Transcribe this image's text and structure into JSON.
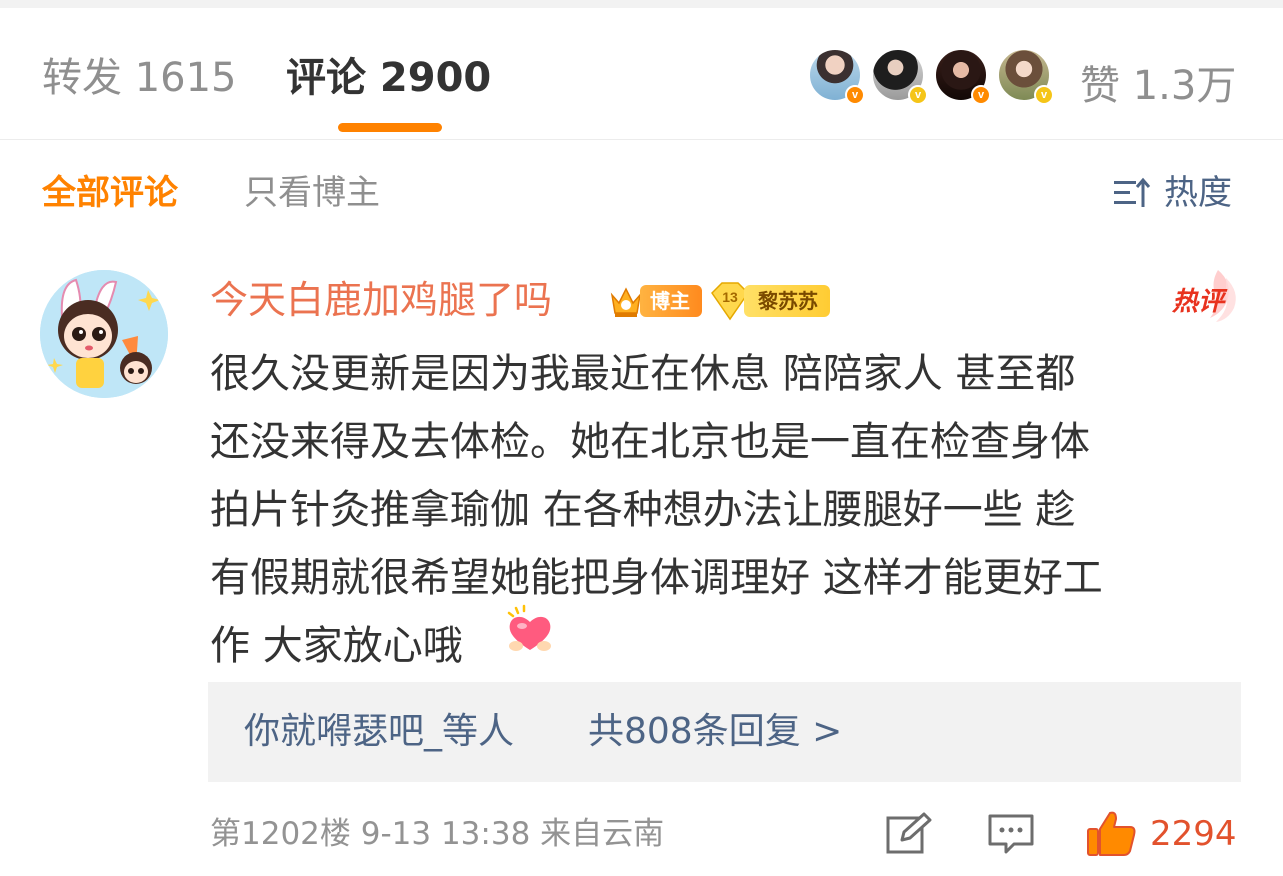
{
  "tabs": {
    "repost": "转发 1615",
    "comments": "评论 2900",
    "like_count": "赞 1.3万"
  },
  "filters": {
    "all": "全部评论",
    "blogger_only": "只看博主",
    "sort": "热度"
  },
  "comment": {
    "username": "今天白鹿加鸡腿了吗",
    "badge_blogger": "博主",
    "badge_fan_level": "13",
    "badge_fan_name": "黎苏苏",
    "hot_tag": "热评",
    "text": "很久没更新是因为我最近在休息 陪陪家人 甚至都\n还没来得及去体检。她在北京也是一直在检查身体\n拍片针灸推拿瑜伽 在各种想办法让腰腿好一些 趁\n有假期就很希望她能把身体调理好 这样才能更好工\n作 大家放心哦",
    "replies_users": "你就嘚瑟吧_等人",
    "replies_count": "共808条回复 >",
    "meta": "第1202楼 9-13 13:38 来自云南",
    "likes": "2294"
  },
  "colors": {
    "accent": "#ff8200",
    "username": "#eb7350",
    "link": "#4d6485",
    "muted": "#939393",
    "like": "#e2522d"
  },
  "icons": [
    "sort-icon",
    "edit-icon",
    "comment-icon",
    "thumbs-up-icon",
    "heart-emoji-icon",
    "verified-badge-icon",
    "crown-icon"
  ]
}
